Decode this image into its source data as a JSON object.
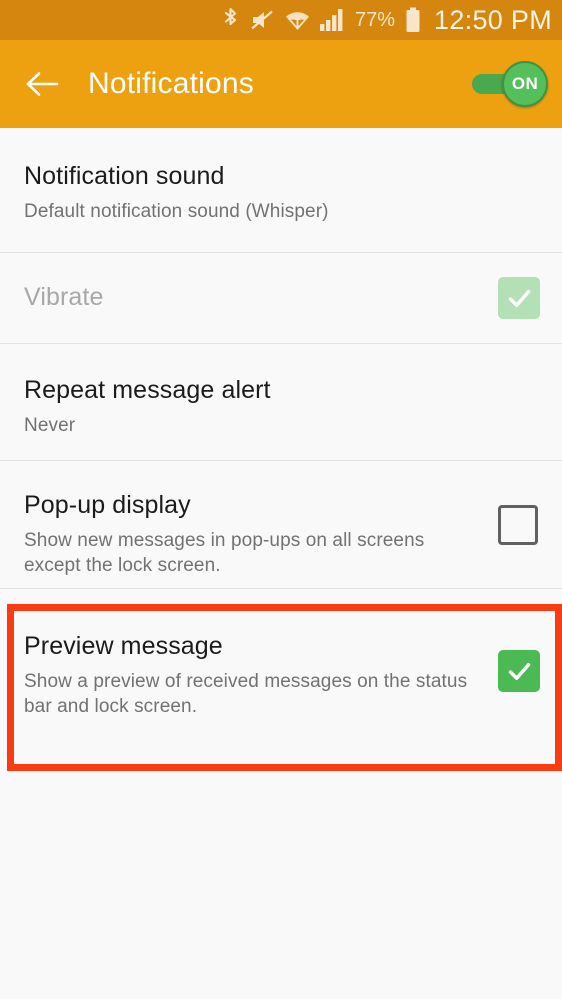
{
  "status_bar": {
    "icons": [
      "bluetooth-icon",
      "sound-mute-icon",
      "wifi-icon",
      "cellular-signal-icon",
      "battery-icon"
    ],
    "battery_percent": "77%",
    "time": "12:50 PM",
    "background_color": "#d5860e",
    "text_color": "#f7e6ca"
  },
  "app_bar": {
    "back_label": "back",
    "title": "Notifications",
    "toggle": {
      "state": "ON",
      "label": "ON",
      "on_color": "#54bf5b",
      "track_color": "#4aa84e"
    },
    "background_color": "#eda111"
  },
  "settings": {
    "items": [
      {
        "title": "Notification sound",
        "subtitle": "Default notification sound (Whisper)",
        "control": "none",
        "enabled": true
      },
      {
        "title": "Vibrate",
        "subtitle": "",
        "control": "checkbox",
        "checked": true,
        "enabled": false
      },
      {
        "title": "Repeat message alert",
        "subtitle": "Never",
        "control": "none",
        "enabled": true
      },
      {
        "title": "Pop-up display",
        "subtitle": "Show new messages in pop-ups on all screens except the lock screen.",
        "control": "checkbox",
        "checked": false,
        "enabled": true
      },
      {
        "title": "Preview message",
        "subtitle": "Show a preview of received messages on the status bar and lock screen.",
        "control": "checkbox",
        "checked": true,
        "enabled": true,
        "highlighted": true
      }
    ]
  },
  "highlight": {
    "target": "Preview message",
    "color": "#f93c13"
  },
  "colors": {
    "page_background": "#f9f9f9",
    "divider": "#e2e2e2",
    "title_text": "#1b1b1b",
    "subtitle_text": "#727272",
    "disabled_text": "#a8a8a8",
    "checkbox_on": "#4bba54",
    "checkbox_disabled": "#b3e0b5",
    "checkbox_off_border": "#616161"
  }
}
